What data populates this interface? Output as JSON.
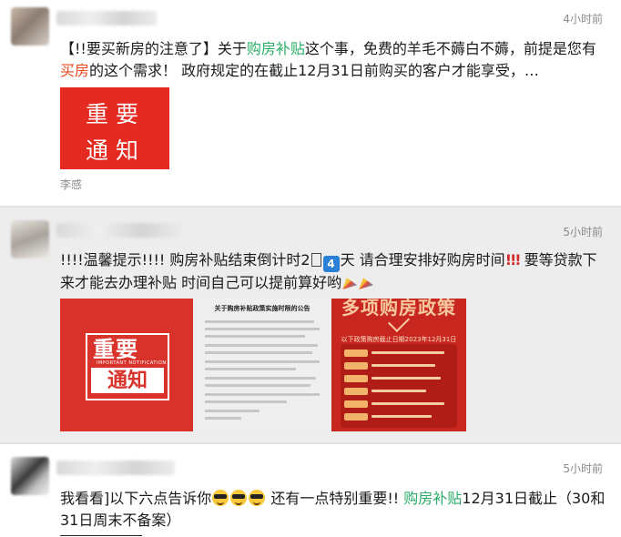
{
  "posts": [
    {
      "time": "4小时前",
      "text_parts": [
        "【!!要买新房的注意了】关于",
        "购房补贴",
        "这个事，免费的羊毛不薅白不薅，前提是您有",
        "买房",
        "的这个需求！  政府规定的在截止12月31日前购买的客户才能享受，…"
      ],
      "image": {
        "line1": "重要",
        "line2": "通知"
      },
      "source": "李感"
    },
    {
      "time": "5小时前",
      "text_parts": [
        "!!!!温馨提示!!!! 购房补贴结束倒计时2",
        "4",
        "天 请合理安排好购房时间",
        "!!!",
        " 要等贷款下来才能去办理补贴 时间自己可以提前算好哟"
      ],
      "images": [
        {
          "big1": "重要",
          "sub": "IMPORTANT NOTIFICATION",
          "big2": "通知"
        },
        {
          "title": "关于购房补贴政策实施时限的公告"
        },
        {
          "head": "多项购房政策",
          "sub": "以下政策购房截止日期2023年12月31日"
        }
      ]
    },
    {
      "time": "5小时前",
      "text_parts": [
        "我看看]以下六点告诉你",
        " 还有一点特别重要!! ",
        "购房补贴",
        "12月31日截止（30和31日周末不备案）"
      ]
    }
  ],
  "colors": {
    "highlight_green": "#2aae67",
    "highlight_orange": "#e8491d",
    "notice_red": "#e42a21"
  },
  "icons": [
    "number-4-emoji-icon",
    "red-exclamation-icon",
    "party-popper-icon",
    "cool-sunglasses-emoji-icon"
  ]
}
